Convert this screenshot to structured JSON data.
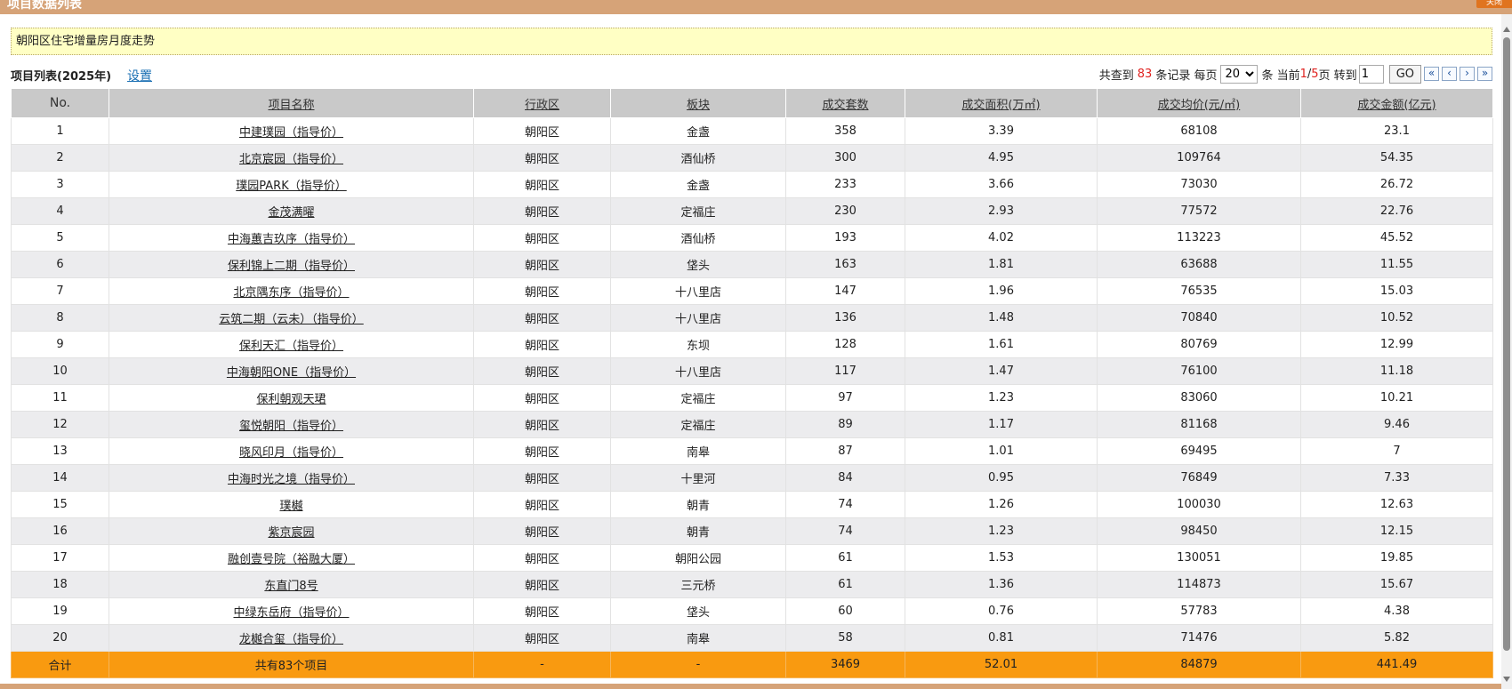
{
  "window": {
    "title": "项目数据列表",
    "close_label": "关闭"
  },
  "trend_link": "朝阳区住宅增量房月度走势",
  "list": {
    "title": "项目列表(2025年)",
    "setting_label": "设置"
  },
  "pager": {
    "found_prefix": "共查到",
    "total_records": "83",
    "records_suffix": "条记录 每页",
    "per_page": "20",
    "per_page_suffix": "条 当前",
    "current_page": "1",
    "slash": "/",
    "total_pages": "5",
    "page_suffix": "页 转到",
    "goto_value": "1",
    "go_label": "GO",
    "first_label": "«",
    "prev_label": "‹",
    "next_label": "›",
    "last_label": "»"
  },
  "table": {
    "headers": [
      "No.",
      "项目名称",
      "行政区",
      "板块",
      "成交套数",
      "成交面积(万㎡)",
      "成交均价(元/㎡)",
      "成交金额(亿元)"
    ],
    "rows": [
      [
        "1",
        "中建璞园（指导价）",
        "朝阳区",
        "金盏",
        "358",
        "3.39",
        "68108",
        "23.1"
      ],
      [
        "2",
        "北京宸园（指导价）",
        "朝阳区",
        "酒仙桥",
        "300",
        "4.95",
        "109764",
        "54.35"
      ],
      [
        "3",
        "璞园PARK（指导价）",
        "朝阳区",
        "金盏",
        "233",
        "3.66",
        "73030",
        "26.72"
      ],
      [
        "4",
        "金茂满曜",
        "朝阳区",
        "定福庄",
        "230",
        "2.93",
        "77572",
        "22.76"
      ],
      [
        "5",
        "中海蕙吉玖序（指导价）",
        "朝阳区",
        "酒仙桥",
        "193",
        "4.02",
        "113223",
        "45.52"
      ],
      [
        "6",
        "保利锦上二期（指导价）",
        "朝阳区",
        "垡头",
        "163",
        "1.81",
        "63688",
        "11.55"
      ],
      [
        "7",
        "北京隅东序（指导价）",
        "朝阳区",
        "十八里店",
        "147",
        "1.96",
        "76535",
        "15.03"
      ],
      [
        "8",
        "云筑二期（云未）（指导价）",
        "朝阳区",
        "十八里店",
        "136",
        "1.48",
        "70840",
        "10.52"
      ],
      [
        "9",
        "保利天汇（指导价）",
        "朝阳区",
        "东坝",
        "128",
        "1.61",
        "80769",
        "12.99"
      ],
      [
        "10",
        "中海朝阳ONE（指导价）",
        "朝阳区",
        "十八里店",
        "117",
        "1.47",
        "76100",
        "11.18"
      ],
      [
        "11",
        "保利朝观天珺",
        "朝阳区",
        "定福庄",
        "97",
        "1.23",
        "83060",
        "10.21"
      ],
      [
        "12",
        "玺悦朝阳（指导价）",
        "朝阳区",
        "定福庄",
        "89",
        "1.17",
        "81168",
        "9.46"
      ],
      [
        "13",
        "晓风印月（指导价）",
        "朝阳区",
        "南皋",
        "87",
        "1.01",
        "69495",
        "7"
      ],
      [
        "14",
        "中海时光之境（指导价）",
        "朝阳区",
        "十里河",
        "84",
        "0.95",
        "76849",
        "7.33"
      ],
      [
        "15",
        "璞樾",
        "朝阳区",
        "朝青",
        "74",
        "1.26",
        "100030",
        "12.63"
      ],
      [
        "16",
        "紫京宸园",
        "朝阳区",
        "朝青",
        "74",
        "1.23",
        "98450",
        "12.15"
      ],
      [
        "17",
        "融创壹号院（裕融大厦）",
        "朝阳区",
        "朝阳公园",
        "61",
        "1.53",
        "130051",
        "19.85"
      ],
      [
        "18",
        "东直门8号",
        "朝阳区",
        "三元桥",
        "61",
        "1.36",
        "114873",
        "15.67"
      ],
      [
        "19",
        "中绿东岳府（指导价）",
        "朝阳区",
        "垡头",
        "60",
        "0.76",
        "57783",
        "4.38"
      ],
      [
        "20",
        "龙樾合玺（指导价）",
        "朝阳区",
        "南皋",
        "58",
        "0.81",
        "71476",
        "5.82"
      ]
    ],
    "footer": [
      "合计",
      "共有83个项目",
      "-",
      "-",
      "3469",
      "52.01",
      "84879",
      "441.49"
    ]
  }
}
